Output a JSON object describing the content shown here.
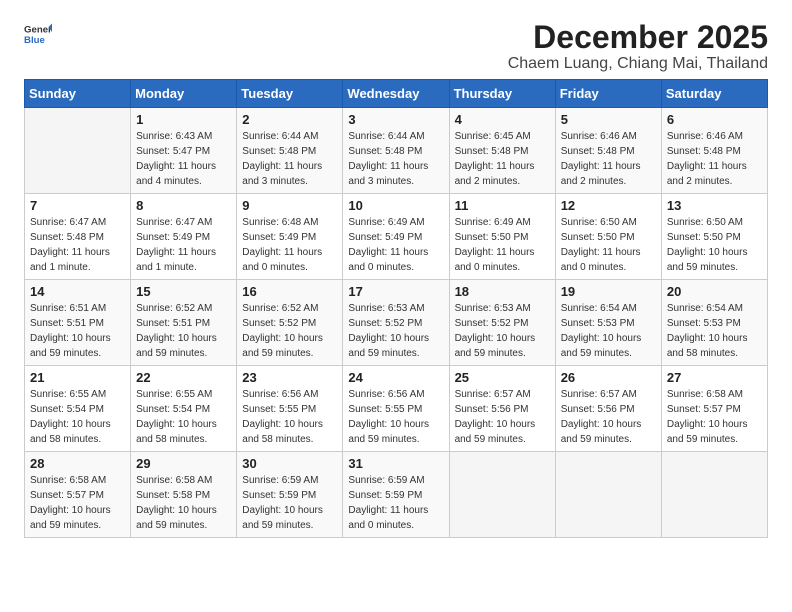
{
  "logo": {
    "general": "General",
    "blue": "Blue"
  },
  "header": {
    "title": "December 2025",
    "subtitle": "Chaem Luang, Chiang Mai, Thailand"
  },
  "weekdays": [
    "Sunday",
    "Monday",
    "Tuesday",
    "Wednesday",
    "Thursday",
    "Friday",
    "Saturday"
  ],
  "weeks": [
    [
      {
        "day": "",
        "info": ""
      },
      {
        "day": "1",
        "info": "Sunrise: 6:43 AM\nSunset: 5:47 PM\nDaylight: 11 hours\nand 4 minutes."
      },
      {
        "day": "2",
        "info": "Sunrise: 6:44 AM\nSunset: 5:48 PM\nDaylight: 11 hours\nand 3 minutes."
      },
      {
        "day": "3",
        "info": "Sunrise: 6:44 AM\nSunset: 5:48 PM\nDaylight: 11 hours\nand 3 minutes."
      },
      {
        "day": "4",
        "info": "Sunrise: 6:45 AM\nSunset: 5:48 PM\nDaylight: 11 hours\nand 2 minutes."
      },
      {
        "day": "5",
        "info": "Sunrise: 6:46 AM\nSunset: 5:48 PM\nDaylight: 11 hours\nand 2 minutes."
      },
      {
        "day": "6",
        "info": "Sunrise: 6:46 AM\nSunset: 5:48 PM\nDaylight: 11 hours\nand 2 minutes."
      }
    ],
    [
      {
        "day": "7",
        "info": "Sunrise: 6:47 AM\nSunset: 5:48 PM\nDaylight: 11 hours\nand 1 minute."
      },
      {
        "day": "8",
        "info": "Sunrise: 6:47 AM\nSunset: 5:49 PM\nDaylight: 11 hours\nand 1 minute."
      },
      {
        "day": "9",
        "info": "Sunrise: 6:48 AM\nSunset: 5:49 PM\nDaylight: 11 hours\nand 0 minutes."
      },
      {
        "day": "10",
        "info": "Sunrise: 6:49 AM\nSunset: 5:49 PM\nDaylight: 11 hours\nand 0 minutes."
      },
      {
        "day": "11",
        "info": "Sunrise: 6:49 AM\nSunset: 5:50 PM\nDaylight: 11 hours\nand 0 minutes."
      },
      {
        "day": "12",
        "info": "Sunrise: 6:50 AM\nSunset: 5:50 PM\nDaylight: 11 hours\nand 0 minutes."
      },
      {
        "day": "13",
        "info": "Sunrise: 6:50 AM\nSunset: 5:50 PM\nDaylight: 10 hours\nand 59 minutes."
      }
    ],
    [
      {
        "day": "14",
        "info": "Sunrise: 6:51 AM\nSunset: 5:51 PM\nDaylight: 10 hours\nand 59 minutes."
      },
      {
        "day": "15",
        "info": "Sunrise: 6:52 AM\nSunset: 5:51 PM\nDaylight: 10 hours\nand 59 minutes."
      },
      {
        "day": "16",
        "info": "Sunrise: 6:52 AM\nSunset: 5:52 PM\nDaylight: 10 hours\nand 59 minutes."
      },
      {
        "day": "17",
        "info": "Sunrise: 6:53 AM\nSunset: 5:52 PM\nDaylight: 10 hours\nand 59 minutes."
      },
      {
        "day": "18",
        "info": "Sunrise: 6:53 AM\nSunset: 5:52 PM\nDaylight: 10 hours\nand 59 minutes."
      },
      {
        "day": "19",
        "info": "Sunrise: 6:54 AM\nSunset: 5:53 PM\nDaylight: 10 hours\nand 59 minutes."
      },
      {
        "day": "20",
        "info": "Sunrise: 6:54 AM\nSunset: 5:53 PM\nDaylight: 10 hours\nand 58 minutes."
      }
    ],
    [
      {
        "day": "21",
        "info": "Sunrise: 6:55 AM\nSunset: 5:54 PM\nDaylight: 10 hours\nand 58 minutes."
      },
      {
        "day": "22",
        "info": "Sunrise: 6:55 AM\nSunset: 5:54 PM\nDaylight: 10 hours\nand 58 minutes."
      },
      {
        "day": "23",
        "info": "Sunrise: 6:56 AM\nSunset: 5:55 PM\nDaylight: 10 hours\nand 58 minutes."
      },
      {
        "day": "24",
        "info": "Sunrise: 6:56 AM\nSunset: 5:55 PM\nDaylight: 10 hours\nand 59 minutes."
      },
      {
        "day": "25",
        "info": "Sunrise: 6:57 AM\nSunset: 5:56 PM\nDaylight: 10 hours\nand 59 minutes."
      },
      {
        "day": "26",
        "info": "Sunrise: 6:57 AM\nSunset: 5:56 PM\nDaylight: 10 hours\nand 59 minutes."
      },
      {
        "day": "27",
        "info": "Sunrise: 6:58 AM\nSunset: 5:57 PM\nDaylight: 10 hours\nand 59 minutes."
      }
    ],
    [
      {
        "day": "28",
        "info": "Sunrise: 6:58 AM\nSunset: 5:57 PM\nDaylight: 10 hours\nand 59 minutes."
      },
      {
        "day": "29",
        "info": "Sunrise: 6:58 AM\nSunset: 5:58 PM\nDaylight: 10 hours\nand 59 minutes."
      },
      {
        "day": "30",
        "info": "Sunrise: 6:59 AM\nSunset: 5:59 PM\nDaylight: 10 hours\nand 59 minutes."
      },
      {
        "day": "31",
        "info": "Sunrise: 6:59 AM\nSunset: 5:59 PM\nDaylight: 11 hours\nand 0 minutes."
      },
      {
        "day": "",
        "info": ""
      },
      {
        "day": "",
        "info": ""
      },
      {
        "day": "",
        "info": ""
      }
    ]
  ]
}
